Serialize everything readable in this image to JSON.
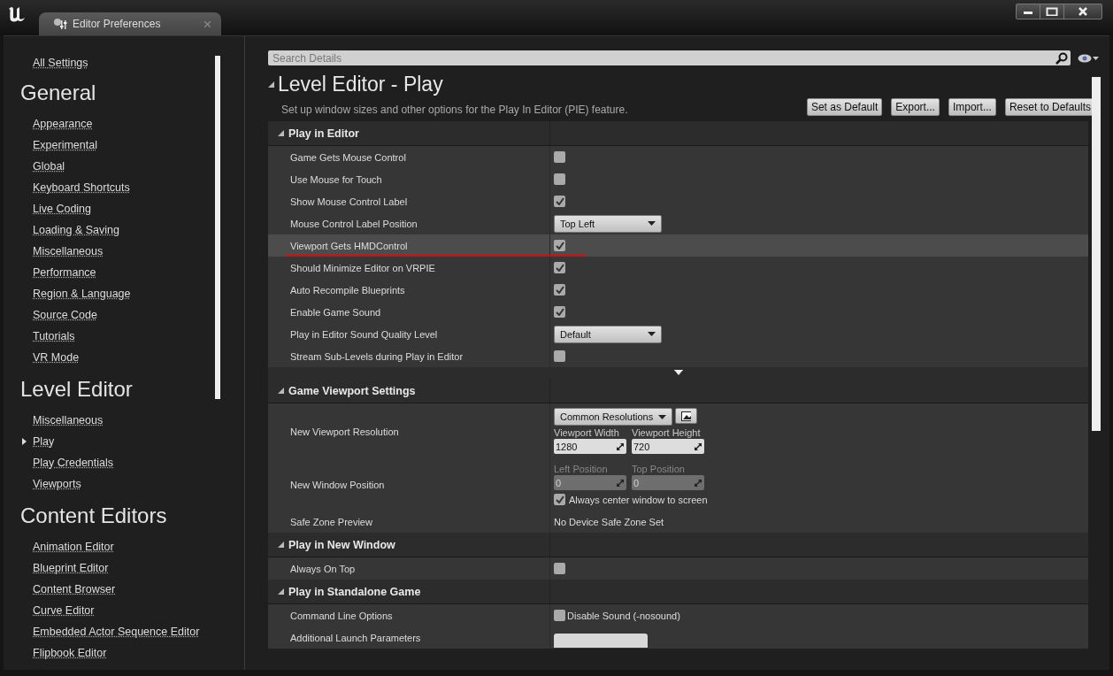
{
  "window": {
    "tab": "Editor Preferences"
  },
  "sidebar": {
    "top_link": "All Settings",
    "groups": [
      {
        "title": "General",
        "items": [
          {
            "label": "Appearance",
            "selected": false
          },
          {
            "label": "Experimental",
            "selected": false
          },
          {
            "label": "Global",
            "selected": false
          },
          {
            "label": "Keyboard Shortcuts",
            "selected": false
          },
          {
            "label": "Live Coding",
            "selected": false
          },
          {
            "label": "Loading & Saving",
            "selected": false
          },
          {
            "label": "Miscellaneous",
            "selected": false
          },
          {
            "label": "Performance",
            "selected": false
          },
          {
            "label": "Region & Language",
            "selected": false
          },
          {
            "label": "Source Code",
            "selected": false
          },
          {
            "label": "Tutorials",
            "selected": false
          },
          {
            "label": "VR Mode",
            "selected": false
          }
        ]
      },
      {
        "title": "Level Editor",
        "items": [
          {
            "label": "Miscellaneous",
            "selected": false
          },
          {
            "label": "Play",
            "selected": true
          },
          {
            "label": "Play Credentials",
            "selected": false
          },
          {
            "label": "Viewports",
            "selected": false
          }
        ]
      },
      {
        "title": "Content Editors",
        "items": [
          {
            "label": "Animation Editor",
            "selected": false
          },
          {
            "label": "Blueprint Editor",
            "selected": false
          },
          {
            "label": "Content Browser",
            "selected": false
          },
          {
            "label": "Curve Editor",
            "selected": false
          },
          {
            "label": "Embedded Actor Sequence Editor",
            "selected": false
          },
          {
            "label": "Flipbook Editor",
            "selected": false
          }
        ]
      }
    ]
  },
  "search": {
    "placeholder": "Search Details"
  },
  "page": {
    "title": "Level Editor - Play",
    "description": "Set up window sizes and other options for the Play In Editor (PIE) feature.",
    "buttons": [
      "Set as Default",
      "Export...",
      "Import...",
      "Reset to Defaults"
    ]
  },
  "sections": [
    {
      "title": "Play in Editor",
      "advanced_toggle": true,
      "rows": [
        {
          "kind": "checkbox",
          "label": "Game Gets Mouse Control",
          "checked": false,
          "highlighted": false
        },
        {
          "kind": "checkbox",
          "label": "Use Mouse for Touch",
          "checked": false,
          "highlighted": false
        },
        {
          "kind": "checkbox",
          "label": "Show Mouse Control Label",
          "checked": true,
          "highlighted": false
        },
        {
          "kind": "dropdown",
          "label": "Mouse Control Label Position",
          "value": "Top Left",
          "highlighted": false
        },
        {
          "kind": "checkbox",
          "label": "Viewport Gets HMDControl",
          "checked": true,
          "highlighted": true
        },
        {
          "kind": "checkbox",
          "label": "Should Minimize Editor on VRPIE",
          "checked": true,
          "highlighted": false
        },
        {
          "kind": "checkbox",
          "label": "Auto Recompile Blueprints",
          "checked": true,
          "highlighted": false
        },
        {
          "kind": "checkbox",
          "label": "Enable Game Sound",
          "checked": true,
          "highlighted": false
        },
        {
          "kind": "dropdown",
          "label": "Play in Editor Sound Quality Level",
          "value": "Default",
          "highlighted": false
        },
        {
          "kind": "checkbox",
          "label": "Stream Sub-Levels during Play in Editor",
          "checked": false,
          "highlighted": false
        }
      ]
    },
    {
      "title": "Game Viewport Settings",
      "advanced_toggle": false,
      "rows": [
        {
          "kind": "resolution",
          "label": "New Viewport Resolution",
          "preset": "Common Resolutions",
          "fields": [
            {
              "label": "Viewport Width",
              "value": "1280",
              "disabled": false
            },
            {
              "label": "Viewport Height",
              "value": "720",
              "disabled": false
            }
          ],
          "highlighted": false
        },
        {
          "kind": "position",
          "label": "New Window Position",
          "fields": [
            {
              "label": "Left Position",
              "value": "0",
              "disabled": true
            },
            {
              "label": "Top Position",
              "value": "0",
              "disabled": true
            }
          ],
          "option": {
            "label": "Always center window to screen",
            "checked": true
          },
          "highlighted": false
        },
        {
          "kind": "text",
          "label": "Safe Zone Preview",
          "value": "No Device Safe Zone Set",
          "highlighted": false
        }
      ]
    },
    {
      "title": "Play in New Window",
      "advanced_toggle": false,
      "rows": [
        {
          "kind": "checkbox",
          "label": "Always On Top",
          "checked": false,
          "highlighted": false
        }
      ]
    },
    {
      "title": "Play in Standalone Game",
      "advanced_toggle": false,
      "rows": [
        {
          "kind": "checkbox",
          "label": "Command Line Options",
          "checked": false,
          "text": "Disable Sound (-nosound)",
          "highlighted": false
        },
        {
          "kind": "textfield",
          "label": "Additional Launch Parameters",
          "highlighted": false
        }
      ]
    }
  ]
}
